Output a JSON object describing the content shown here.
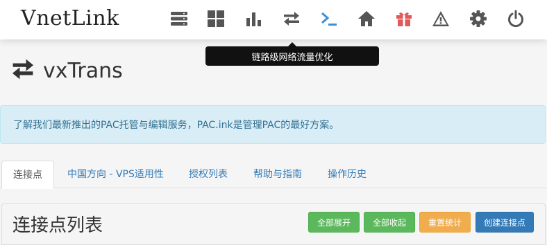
{
  "navbar": {
    "brand": "VnetLink",
    "icons": [
      {
        "name": "server-icon",
        "color": "#555555"
      },
      {
        "name": "grid-icon",
        "color": "#555555"
      },
      {
        "name": "bar-chart-icon",
        "color": "#555555"
      },
      {
        "name": "exchange-icon",
        "color": "#555555"
      },
      {
        "name": "terminal-icon",
        "color": "#3a8fd6"
      },
      {
        "name": "home-icon",
        "color": "#555555"
      },
      {
        "name": "gift-icon",
        "color": "#e05a5a"
      },
      {
        "name": "warning-icon",
        "color": "#555555"
      },
      {
        "name": "gear-icon",
        "color": "#555555"
      },
      {
        "name": "power-icon",
        "color": "#555555"
      }
    ]
  },
  "tooltip": {
    "text": "链路级网络流量优化"
  },
  "page": {
    "title": "vxTrans",
    "icon": "exchange-icon"
  },
  "alert": {
    "text": "了解我们最新推出的PAC托管与编辑服务，PAC.ink是管理PAC的最好方案。"
  },
  "tabs": [
    {
      "label": "连接点",
      "active": true
    },
    {
      "label": "中国方向 - VPS适用性",
      "active": false
    },
    {
      "label": "授权列表",
      "active": false
    },
    {
      "label": "帮助与指南",
      "active": false
    },
    {
      "label": "操作历史",
      "active": false
    }
  ],
  "panel": {
    "title": "连接点列表",
    "buttons": [
      {
        "label": "全部展开",
        "style": "green"
      },
      {
        "label": "全部收起",
        "style": "green"
      },
      {
        "label": "重置统计",
        "style": "orange"
      },
      {
        "label": "创建连接点",
        "style": "blue"
      }
    ]
  }
}
